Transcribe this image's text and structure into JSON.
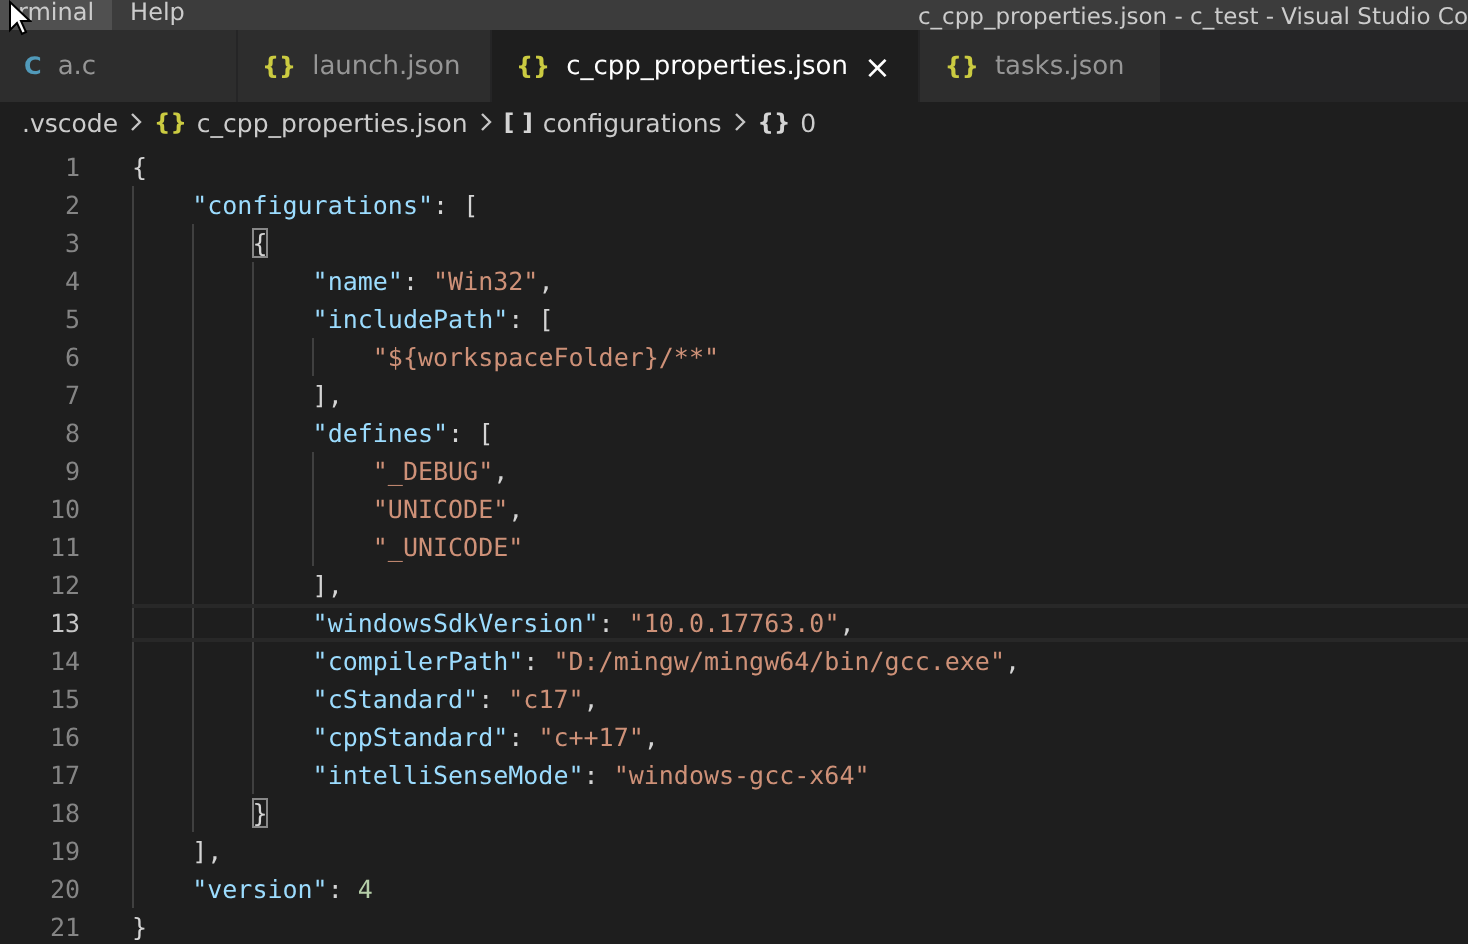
{
  "menu": [
    {
      "label": "rminal",
      "hovered": true
    },
    {
      "label": "Help",
      "hovered": false
    }
  ],
  "window": {
    "title": "c_cpp_properties.json - c_test - Visual Studio Co"
  },
  "tabs": [
    {
      "icon": "C",
      "color": "#519aba",
      "label": "a.c",
      "selected": false
    },
    {
      "icon": "{}",
      "color": "#cbcb41",
      "label": "launch.json",
      "selected": false
    },
    {
      "icon": "{}",
      "color": "#cbcb41",
      "label": "c_cpp_properties.json",
      "selected": true,
      "close": "×"
    },
    {
      "icon": "{}",
      "color": "#cbcb41",
      "label": "tasks.json",
      "selected": false
    }
  ],
  "breadcrumbs": [
    {
      "label": ".vscode"
    },
    {
      "icon": "{}",
      "color": "#cbcb41",
      "label": "c_cpp_properties.json"
    },
    {
      "icon": "[ ]",
      "color": "#d4d4d4",
      "label": "configurations"
    },
    {
      "icon": "{}",
      "color": "#d4d4d4",
      "label": "0"
    }
  ],
  "editor": {
    "lines": [
      {
        "number": "1",
        "current": false,
        "tokens": [
          {
            "kind": "punct",
            "text": "{"
          }
        ],
        "children": [
          {
            "number": "2",
            "current": false,
            "tokens": [
              {
                "kind": "key",
                "text": "\"configurations\""
              },
              {
                "kind": "punct",
                "text": ": ["
              }
            ],
            "children": [
              {
                "number": "3",
                "current": false,
                "tokens": [
                  {
                    "kind": "punct",
                    "text": "{",
                    "matched": true
                  }
                ],
                "children": [
                  {
                    "number": "4",
                    "current": false,
                    "tokens": [
                      {
                        "kind": "key",
                        "text": "\"name\""
                      },
                      {
                        "kind": "punct",
                        "text": ": "
                      },
                      {
                        "kind": "string",
                        "text": "\"Win32\""
                      },
                      {
                        "kind": "punct",
                        "text": ","
                      }
                    ]
                  },
                  {
                    "number": "5",
                    "current": false,
                    "tokens": [
                      {
                        "kind": "key",
                        "text": "\"includePath\""
                      },
                      {
                        "kind": "punct",
                        "text": ": ["
                      }
                    ],
                    "children": [
                      {
                        "number": "6",
                        "current": false,
                        "tokens": [
                          {
                            "kind": "string",
                            "text": "\"${workspaceFolder}/**\""
                          }
                        ]
                      }
                    ]
                  },
                  {
                    "number": "7",
                    "current": false,
                    "tokens": [
                      {
                        "kind": "punct",
                        "text": "],"
                      }
                    ]
                  },
                  {
                    "number": "8",
                    "current": false,
                    "tokens": [
                      {
                        "kind": "key",
                        "text": "\"defines\""
                      },
                      {
                        "kind": "punct",
                        "text": ": ["
                      }
                    ],
                    "children": [
                      {
                        "number": "9",
                        "current": false,
                        "tokens": [
                          {
                            "kind": "string",
                            "text": "\"_DEBUG\""
                          },
                          {
                            "kind": "punct",
                            "text": ","
                          }
                        ]
                      },
                      {
                        "number": "10",
                        "current": false,
                        "tokens": [
                          {
                            "kind": "string",
                            "text": "\"UNICODE\""
                          },
                          {
                            "kind": "punct",
                            "text": ","
                          }
                        ]
                      },
                      {
                        "number": "11",
                        "current": false,
                        "tokens": [
                          {
                            "kind": "string",
                            "text": "\"_UNICODE\""
                          }
                        ]
                      }
                    ]
                  },
                  {
                    "number": "12",
                    "current": false,
                    "tokens": [
                      {
                        "kind": "punct",
                        "text": "],"
                      }
                    ]
                  },
                  {
                    "number": "13",
                    "current": true,
                    "tokens": [
                      {
                        "kind": "key",
                        "text": "\"windowsSdkVersion\""
                      },
                      {
                        "kind": "punct",
                        "text": ": "
                      },
                      {
                        "kind": "string",
                        "text": "\"10.0.17763.0\""
                      },
                      {
                        "kind": "punct",
                        "text": ","
                      }
                    ]
                  },
                  {
                    "number": "14",
                    "current": false,
                    "tokens": [
                      {
                        "kind": "key",
                        "text": "\"compilerPath\""
                      },
                      {
                        "kind": "punct",
                        "text": ": "
                      },
                      {
                        "kind": "string",
                        "text": "\"D:/mingw/mingw64/bin/gcc.exe\""
                      },
                      {
                        "kind": "punct",
                        "text": ","
                      }
                    ]
                  },
                  {
                    "number": "15",
                    "current": false,
                    "tokens": [
                      {
                        "kind": "key",
                        "text": "\"cStandard\""
                      },
                      {
                        "kind": "punct",
                        "text": ": "
                      },
                      {
                        "kind": "string",
                        "text": "\"c17\""
                      },
                      {
                        "kind": "punct",
                        "text": ","
                      }
                    ]
                  },
                  {
                    "number": "16",
                    "current": false,
                    "tokens": [
                      {
                        "kind": "key",
                        "text": "\"cppStandard\""
                      },
                      {
                        "kind": "punct",
                        "text": ": "
                      },
                      {
                        "kind": "string",
                        "text": "\"c++17\""
                      },
                      {
                        "kind": "punct",
                        "text": ","
                      }
                    ]
                  },
                  {
                    "number": "17",
                    "current": false,
                    "tokens": [
                      {
                        "kind": "key",
                        "text": "\"intelliSenseMode\""
                      },
                      {
                        "kind": "punct",
                        "text": ": "
                      },
                      {
                        "kind": "string",
                        "text": "\"windows-gcc-x64\""
                      }
                    ]
                  }
                ]
              },
              {
                "number": "18",
                "current": false,
                "tokens": [
                  {
                    "kind": "punct",
                    "text": "}",
                    "matched": true
                  }
                ]
              }
            ]
          },
          {
            "number": "19",
            "current": false,
            "tokens": [
              {
                "kind": "punct",
                "text": "],"
              }
            ]
          },
          {
            "number": "20",
            "current": false,
            "tokens": [
              {
                "kind": "key",
                "text": "\"version\""
              },
              {
                "kind": "punct",
                "text": ": "
              },
              {
                "kind": "number",
                "text": "4"
              }
            ]
          }
        ]
      },
      {
        "number": "21",
        "current": false,
        "tokens": [
          {
            "kind": "punct",
            "text": "}"
          }
        ]
      }
    ]
  }
}
